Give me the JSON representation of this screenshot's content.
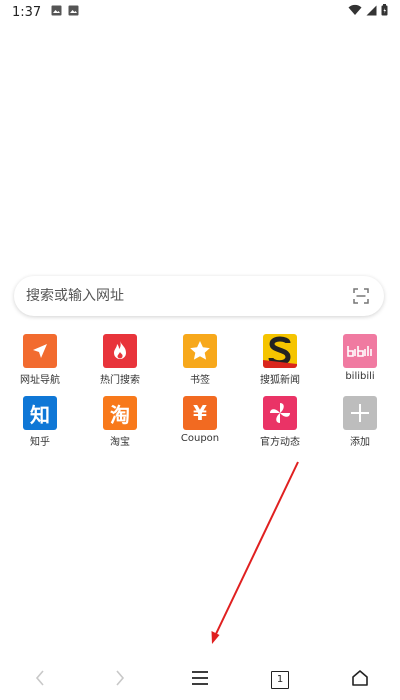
{
  "status_bar": {
    "time": "1:37",
    "notification_icons": [
      "image-icon",
      "image-icon"
    ],
    "system_icons": [
      "wifi-icon",
      "cellular-signal-icon",
      "battery-icon"
    ]
  },
  "search": {
    "placeholder": "搜索或输入网址",
    "value": "",
    "scan_icon": "scan-icon"
  },
  "quick_links": [
    {
      "label": "网址导航",
      "icon": "navigation-arrow-icon",
      "color": "#f26b2f"
    },
    {
      "label": "热门搜索",
      "icon": "flame-icon",
      "color": "#e8343b"
    },
    {
      "label": "书签",
      "icon": "star-icon",
      "color": "#f7a81b"
    },
    {
      "label": "搜狐新闻",
      "icon": "sohu-logo-icon",
      "color": "#f5c400"
    },
    {
      "label": "bilibili",
      "icon": "bilibili-logo-icon",
      "color": "#f07aa1"
    },
    {
      "label": "知乎",
      "icon": "zhihu-logo-icon",
      "color": "#0f77d6",
      "glyph": "知"
    },
    {
      "label": "淘宝",
      "icon": "taobao-logo-icon",
      "color": "#f8791b",
      "glyph": "淘"
    },
    {
      "label": "Coupon",
      "icon": "yen-icon",
      "color": "#f26a21",
      "glyph": "¥"
    },
    {
      "label": "官方动态",
      "icon": "pinwheel-icon",
      "color": "#ea3366"
    },
    {
      "label": "添加",
      "icon": "plus-icon",
      "color": "#bdbdbd"
    }
  ],
  "bottom_nav": [
    {
      "name": "back",
      "icon": "chevron-left-icon",
      "enabled": false
    },
    {
      "name": "forward",
      "icon": "chevron-right-icon",
      "enabled": false
    },
    {
      "name": "menu",
      "icon": "hamburger-menu-icon",
      "enabled": true
    },
    {
      "name": "tabs",
      "icon": "tabs-icon",
      "enabled": true,
      "count": "1"
    },
    {
      "name": "home",
      "icon": "home-icon",
      "enabled": true
    }
  ],
  "colors": {
    "annotation_arrow": "#e02020",
    "disabled_icon": "#c8c8c8",
    "enabled_icon": "#222222"
  }
}
